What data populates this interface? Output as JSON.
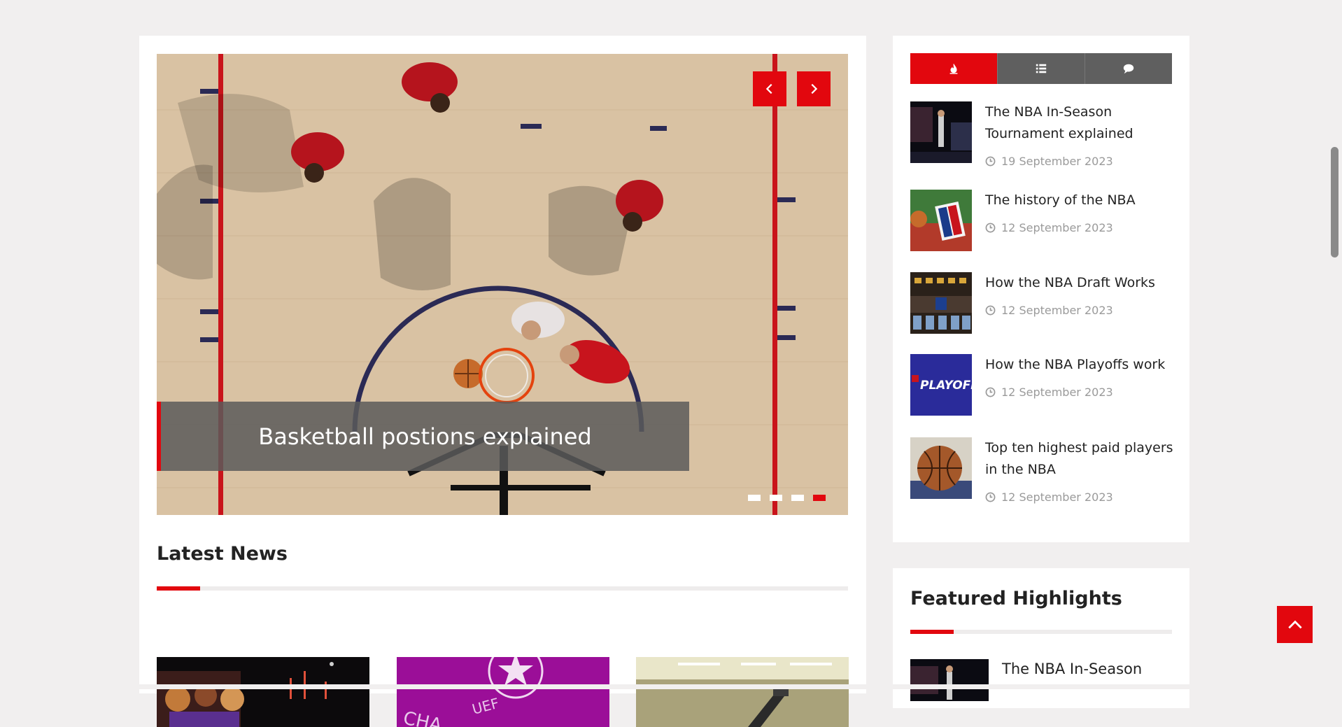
{
  "slider": {
    "caption": "Basketball postions explained",
    "prev_icon": "chevron-left-icon",
    "next_icon": "chevron-right-icon",
    "slide_count": 4,
    "active_slide": 4
  },
  "latest_news": {
    "title": "Latest News"
  },
  "sidebar": {
    "tabs": [
      {
        "icon": "fire-icon",
        "active": true
      },
      {
        "icon": "list-icon",
        "active": false
      },
      {
        "icon": "comment-icon",
        "active": false
      }
    ],
    "posts": [
      {
        "title": "The NBA In-Season Tournament explained",
        "date": "19 September 2023"
      },
      {
        "title": "The history of the NBA",
        "date": "12 September 2023"
      },
      {
        "title": "How the NBA Draft Works",
        "date": "12 September 2023"
      },
      {
        "title": "How the NBA Playoffs work",
        "date": "12 September 2023"
      },
      {
        "title": "Top ten highest paid players in the NBA",
        "date": "12 September 2023"
      }
    ]
  },
  "featured": {
    "title": "Featured Highlights",
    "first_post_title": "The NBA In-Season"
  },
  "colors": {
    "accent": "#e2070e",
    "tab_inactive": "#5f5f5f",
    "page_bg": "#f1efef"
  }
}
